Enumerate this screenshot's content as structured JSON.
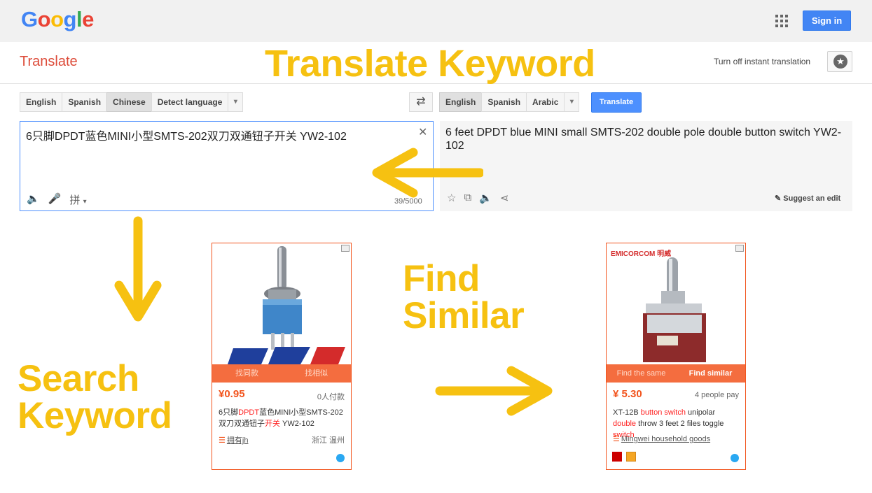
{
  "header": {
    "logo_letters": [
      {
        "ch": "G",
        "color": "#4285f4"
      },
      {
        "ch": "o",
        "color": "#ea4335"
      },
      {
        "ch": "o",
        "color": "#fbbc05"
      },
      {
        "ch": "g",
        "color": "#4285f4"
      },
      {
        "ch": "l",
        "color": "#34a853"
      },
      {
        "ch": "e",
        "color": "#ea4335"
      }
    ],
    "signin_label": "Sign in",
    "apps_icon": "apps-grid-icon"
  },
  "subheader": {
    "title": "Translate",
    "instant_label": "Turn off instant translation",
    "star_icon": "star-icon"
  },
  "annotations": {
    "translate_keyword": "Translate Keyword",
    "find_similar_line1": "Find",
    "find_similar_line2": "Similar",
    "search_keyword_line1": "Search",
    "search_keyword_line2": "Keyword",
    "arrow_color": "#f6c111"
  },
  "source": {
    "langs": [
      "English",
      "Spanish",
      "Chinese",
      "Detect language"
    ],
    "active": "Chinese",
    "text": "6只脚DPDT蓝色MINI小型SMTS-202双刀双通钮子开关 YW2-102",
    "count": "39/5000",
    "ime_label": "拼"
  },
  "target": {
    "langs": [
      "English",
      "Spanish",
      "Arabic"
    ],
    "active": "English",
    "translate_label": "Translate",
    "text": "6 feet DPDT blue MINI small SMTS-202 double pole double button switch YW2-102",
    "suggest_label": "Suggest an edit"
  },
  "cards": [
    {
      "btn_left": "找同款",
      "btn_right": "找相似",
      "price": "¥0.95",
      "pay": "0人付款",
      "title_parts": [
        {
          "t": "6只脚",
          "hl": false
        },
        {
          "t": "DPDT",
          "hl": true
        },
        {
          "t": "蓝色MINI小型SMTS-202双刀双通钮子",
          "hl": false
        },
        {
          "t": "开关",
          "hl": true
        },
        {
          "t": " YW2-102",
          "hl": false
        }
      ],
      "shop": "拥有jh",
      "location": "浙江 温州"
    },
    {
      "brand": "EMICORCOM 明威",
      "btn_left": "Find the same",
      "btn_right": "Find similar",
      "price": "¥ 5.30",
      "pay": "4 people pay",
      "title_parts": [
        {
          "t": "XT-12B ",
          "hl": false
        },
        {
          "t": "button switch",
          "hl": true
        },
        {
          "t": " unipolar ",
          "hl": false
        },
        {
          "t": "double",
          "hl": true
        },
        {
          "t": " throw 3 feet 2 files toggle ",
          "hl": false
        },
        {
          "t": "switch",
          "hl": true
        }
      ],
      "shop": "Mingwei household goods"
    }
  ]
}
